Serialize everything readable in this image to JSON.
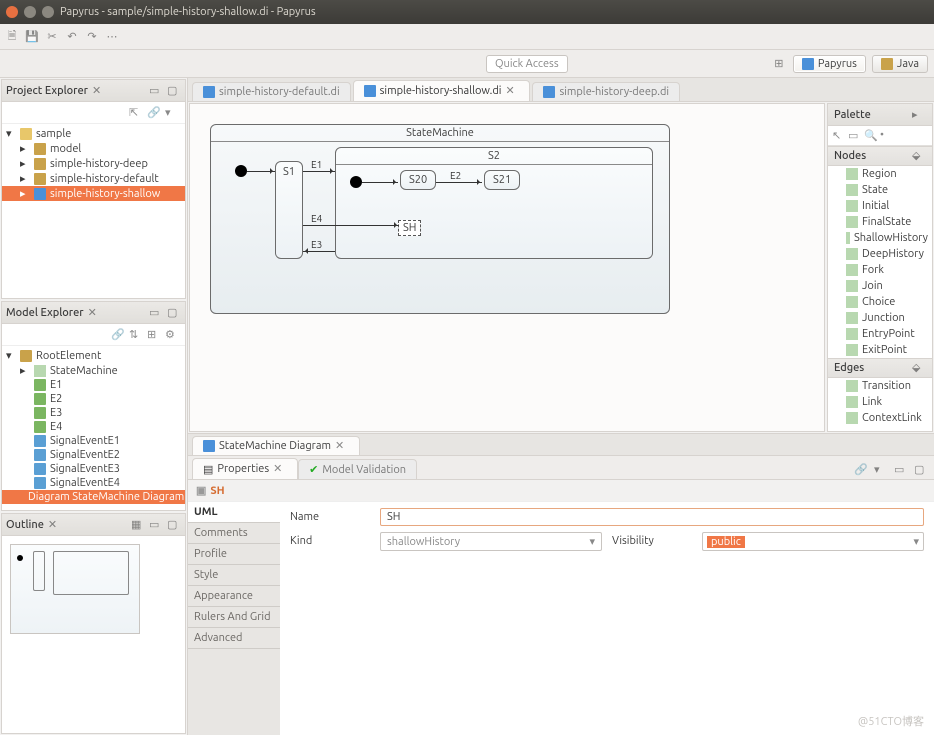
{
  "titlebar": {
    "title": "Papyrus - sample/simple-history-shallow.di - Papyrus"
  },
  "quick_access": {
    "placeholder": "Quick Access"
  },
  "perspectives": {
    "papyrus": "Papyrus",
    "java": "Java"
  },
  "project_explorer": {
    "title": "Project Explorer",
    "items": [
      {
        "label": "sample",
        "icon": "folder",
        "indent": 0,
        "tw": "▾"
      },
      {
        "label": "model",
        "icon": "pkg",
        "indent": 1,
        "tw": "▸"
      },
      {
        "label": "simple-history-deep",
        "icon": "pkg",
        "indent": 1,
        "tw": "▸"
      },
      {
        "label": "simple-history-default",
        "icon": "pkg",
        "indent": 1,
        "tw": "▸"
      },
      {
        "label": "simple-history-shallow",
        "icon": "diag",
        "indent": 1,
        "tw": "▸",
        "selected": true
      }
    ]
  },
  "editor_tabs": [
    {
      "label": "simple-history-default.di",
      "active": false
    },
    {
      "label": "simple-history-shallow.di",
      "active": true
    },
    {
      "label": "simple-history-deep.di",
      "active": false
    }
  ],
  "diagram": {
    "title": "StateMachine",
    "s1": "S1",
    "s2": "S2",
    "s20": "S20",
    "s21": "S21",
    "sh": "SH",
    "e1": "E1",
    "e2": "E2",
    "e3": "E3",
    "e4": "E4"
  },
  "palette": {
    "title": "Palette",
    "groups": {
      "nodes": {
        "title": "Nodes",
        "items": [
          "Region",
          "State",
          "Initial",
          "FinalState",
          "ShallowHistory",
          "DeepHistory",
          "Fork",
          "Join",
          "Choice",
          "Junction",
          "EntryPoint",
          "ExitPoint"
        ]
      },
      "edges": {
        "title": "Edges",
        "items": [
          "Transition",
          "Link",
          "ContextLink"
        ]
      }
    }
  },
  "model_explorer": {
    "title": "Model Explorer",
    "items": [
      {
        "label": "RootElement",
        "icon": "pkg",
        "indent": 0,
        "tw": "▾"
      },
      {
        "label": "StateMachine",
        "icon": "state",
        "indent": 1,
        "tw": "▸"
      },
      {
        "label": "E1",
        "icon": "ev",
        "indent": 1,
        "tw": ""
      },
      {
        "label": "E2",
        "icon": "ev",
        "indent": 1,
        "tw": ""
      },
      {
        "label": "E3",
        "icon": "ev",
        "indent": 1,
        "tw": ""
      },
      {
        "label": "E4",
        "icon": "ev",
        "indent": 1,
        "tw": ""
      },
      {
        "label": "SignalEventE1",
        "icon": "sig",
        "indent": 1,
        "tw": ""
      },
      {
        "label": "SignalEventE2",
        "icon": "sig",
        "indent": 1,
        "tw": ""
      },
      {
        "label": "SignalEventE3",
        "icon": "sig",
        "indent": 1,
        "tw": ""
      },
      {
        "label": "SignalEventE4",
        "icon": "sig",
        "indent": 1,
        "tw": ""
      },
      {
        "label": "Diagram StateMachine Diagram",
        "icon": "diag",
        "indent": 1,
        "tw": "",
        "selected": true
      }
    ]
  },
  "outline": {
    "title": "Outline"
  },
  "bottom_editor_tab": {
    "label": "StateMachine Diagram"
  },
  "bottom_tabs": {
    "properties": "Properties",
    "validation": "Model Validation"
  },
  "properties": {
    "selected": "SH",
    "tabs": [
      "UML",
      "Comments",
      "Profile",
      "Style",
      "Appearance",
      "Rulers And Grid",
      "Advanced"
    ],
    "name_label": "Name",
    "name_value": "SH",
    "kind_label": "Kind",
    "kind_value": "shallowHistory",
    "visibility_label": "Visibility",
    "visibility_value": "public"
  },
  "watermark": "@51CTO博客"
}
